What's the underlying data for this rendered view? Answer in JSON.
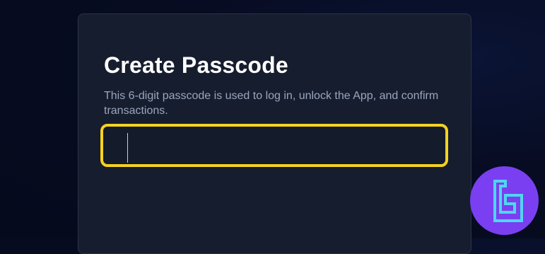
{
  "dialog": {
    "title": "Create Passcode",
    "description": "This 6-digit passcode is used to log in, unlock the App, and confirm transactions.",
    "passcode_value": ""
  },
  "colors": {
    "background": "#050a1c",
    "card": "#161d2e",
    "highlight": "#f5d21f",
    "logo_background": "#7a3ff0",
    "logo_stroke": "#4fd6f0"
  },
  "logo": {
    "icon": "tc-brand-logo-icon"
  }
}
